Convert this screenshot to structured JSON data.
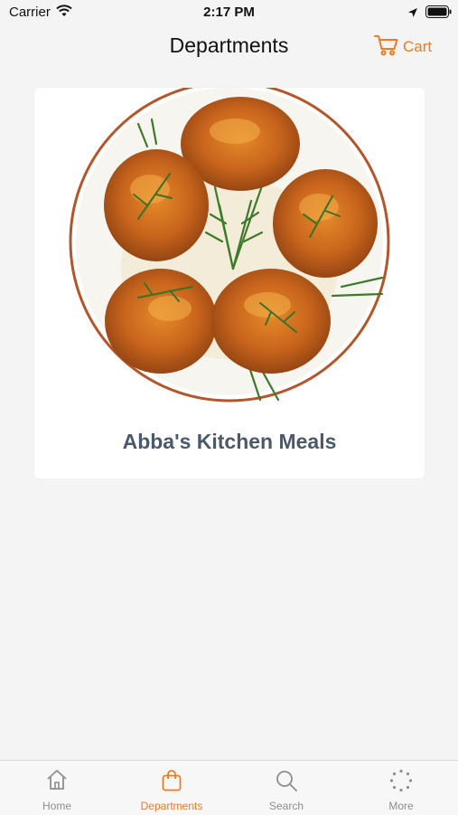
{
  "status_bar": {
    "carrier": "Carrier",
    "time": "2:17 PM"
  },
  "nav": {
    "title": "Departments",
    "cart_label": "Cart",
    "accent": "#ef7a22"
  },
  "departments": [
    {
      "label": "Abba's Kitchen Meals",
      "image": "roasted-chicken-thighs-with-rosemary"
    }
  ],
  "tabs": [
    {
      "label": "Home",
      "icon": "home-icon",
      "active": false
    },
    {
      "label": "Departments",
      "icon": "shopping-bag-icon",
      "active": true
    },
    {
      "label": "Search",
      "icon": "search-icon",
      "active": false
    },
    {
      "label": "More",
      "icon": "more-dots-icon",
      "active": false
    }
  ]
}
